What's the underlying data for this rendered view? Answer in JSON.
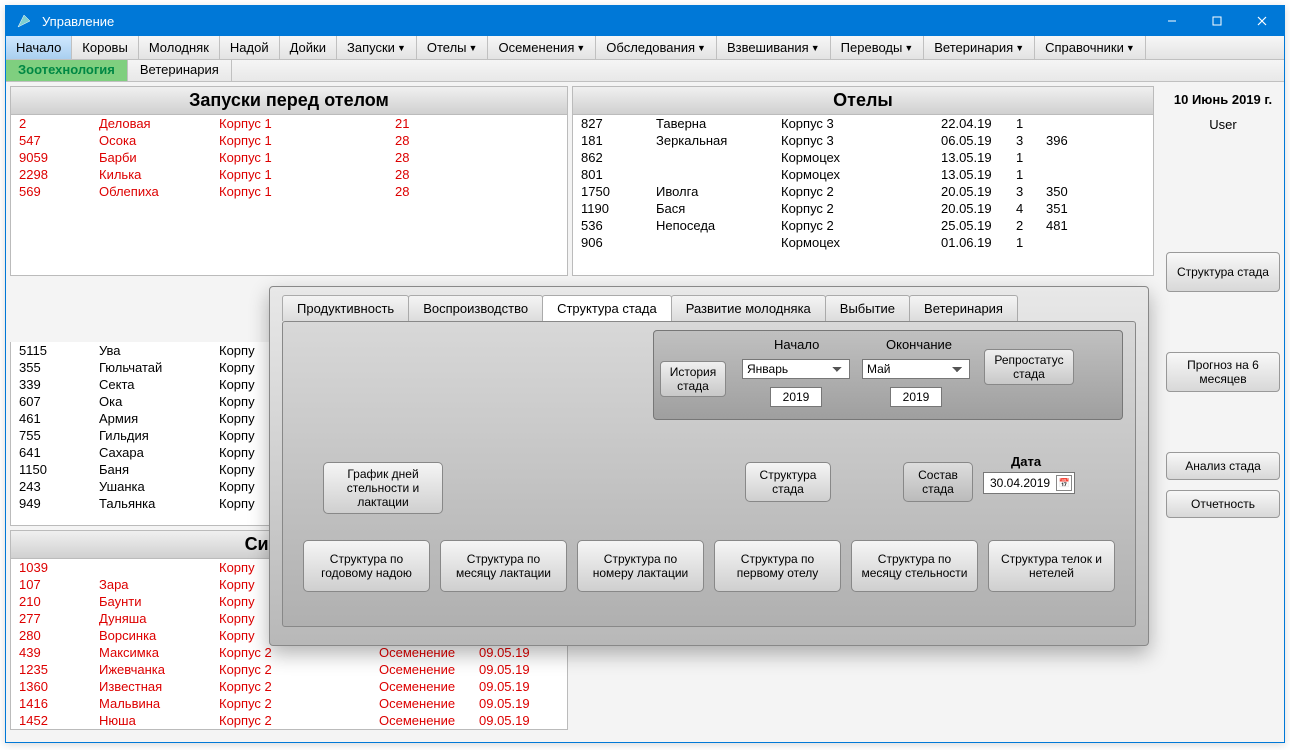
{
  "window": {
    "title": "Управление"
  },
  "menu": {
    "items": [
      {
        "label": "Начало",
        "active": true,
        "dd": false
      },
      {
        "label": "Коровы",
        "dd": false
      },
      {
        "label": "Молодняк",
        "dd": false
      },
      {
        "label": "Надой",
        "dd": false
      },
      {
        "label": "Дойки",
        "dd": false
      },
      {
        "label": "Запуски",
        "dd": true
      },
      {
        "label": "Отелы",
        "dd": true
      },
      {
        "label": "Осеменения",
        "dd": true
      },
      {
        "label": "Обследования",
        "dd": true
      },
      {
        "label": "Взвешивания",
        "dd": true
      },
      {
        "label": "Переводы",
        "dd": true
      },
      {
        "label": "Ветеринария",
        "dd": true
      },
      {
        "label": "Справочники",
        "dd": true
      }
    ]
  },
  "submenu": {
    "items": [
      {
        "label": "Зоотехнология",
        "active": true
      },
      {
        "label": "Ветеринария"
      }
    ]
  },
  "sidebar": {
    "date": "10 Июнь 2019 г.",
    "user": "User",
    "btn_struct": "Структура стада",
    "btn_forecast": "Прогноз на 6 месяцев",
    "btn_analysis": "Анализ стада",
    "btn_report": "Отчетность"
  },
  "panels": {
    "zapuski": {
      "title": "Запуски перед отелом",
      "rows": [
        [
          "2",
          "Деловая",
          "Корпус 1",
          "",
          "21",
          ""
        ],
        [
          "547",
          "Осока",
          "Корпус 1",
          "",
          "28",
          ""
        ],
        [
          "9059",
          "Барби",
          "Корпус 1",
          "",
          "28",
          ""
        ],
        [
          "2298",
          "Килька",
          "Корпус 1",
          "",
          "28",
          ""
        ],
        [
          "569",
          "Облепиха",
          "Корпус 1",
          "",
          "28",
          ""
        ]
      ]
    },
    "otely": {
      "title": "Отелы",
      "rows": [
        [
          "827",
          "Таверна",
          "Корпус 3",
          "22.04.19",
          "1",
          ""
        ],
        [
          "181",
          "Зеркальная",
          "Корпус 3",
          "06.05.19",
          "3",
          "396"
        ],
        [
          "862",
          "",
          "Кормоцех",
          "13.05.19",
          "1",
          ""
        ],
        [
          "801",
          "",
          "Кормоцех",
          "13.05.19",
          "1",
          ""
        ],
        [
          "1750",
          "Иволга",
          "Корпус 2",
          "20.05.19",
          "3",
          "350"
        ],
        [
          "1190",
          "Бася",
          "Корпус 2",
          "20.05.19",
          "4",
          "351"
        ],
        [
          "536",
          "Непоседа",
          "Корпус 2",
          "25.05.19",
          "2",
          "481"
        ],
        [
          "906",
          "",
          "Кормоцех",
          "01.06.19",
          "1",
          ""
        ]
      ]
    },
    "mid": {
      "rows": [
        [
          "5115",
          "Ува",
          "Корпу"
        ],
        [
          "355",
          "Гюльчатай",
          "Корпу"
        ],
        [
          "339",
          "Секта",
          "Корпу"
        ],
        [
          "607",
          "Ока",
          "Корпу"
        ],
        [
          "461",
          "Армия",
          "Корпу"
        ],
        [
          "755",
          "Гильдия",
          "Корпу"
        ],
        [
          "641",
          "Сахара",
          "Корпу"
        ],
        [
          "1150",
          "Баня",
          "Корпу"
        ],
        [
          "243",
          "Ушанка",
          "Корпу"
        ],
        [
          "949",
          "Тальянка",
          "Корпу"
        ]
      ]
    },
    "sync": {
      "title": "Синхрони",
      "rows": [
        [
          "1039",
          "",
          "Корпу",
          "",
          "",
          ""
        ],
        [
          "107",
          "Зара",
          "Корпу",
          "",
          "",
          ""
        ],
        [
          "210",
          "Баунти",
          "Корпу",
          "",
          "",
          ""
        ],
        [
          "277",
          "Дуняша",
          "Корпу",
          "",
          "",
          ""
        ],
        [
          "280",
          "Ворсинка",
          "Корпу",
          "",
          "",
          ""
        ],
        [
          "439",
          "Максимка",
          "Корпус 2",
          "Осеменение",
          "09.05.19",
          ""
        ],
        [
          "1235",
          "Ижевчанка",
          "Корпус 2",
          "Осеменение",
          "09.05.19",
          ""
        ],
        [
          "1360",
          "Известная",
          "Корпус 2",
          "Осеменение",
          "09.05.19",
          ""
        ],
        [
          "1416",
          "Мальвина",
          "Корпус 2",
          "Осеменение",
          "09.05.19",
          ""
        ],
        [
          "1452",
          "Нюша",
          "Корпус 2",
          "Осеменение",
          "09.05.19",
          ""
        ]
      ]
    }
  },
  "dialog": {
    "tabs": [
      "Продуктивность",
      "Воспроизводство",
      "Структура стада",
      "Развитие молодняка",
      "Выбытие",
      "Ветеринария"
    ],
    "active_tab": 2,
    "history_btn": "История стада",
    "start_label": "Начало",
    "end_label": "Окончание",
    "month1": "Январь",
    "month2": "Май",
    "year1": "2019",
    "year2": "2019",
    "repro_btn": "Репростатус стада",
    "grafik_btn": "График дней стельности и лактации",
    "struct_stada_btn": "Структура стада",
    "sostav_btn": "Состав стада",
    "date_label": "Дата",
    "date_value": "30.04.2019",
    "row_btns": [
      "Структура по годовому надою",
      "Структура по месяцу лактации",
      "Структура по номеру лактации",
      "Структура по первому отелу",
      "Структура по месяцу стельности",
      "Структура телок и нетелей"
    ]
  }
}
